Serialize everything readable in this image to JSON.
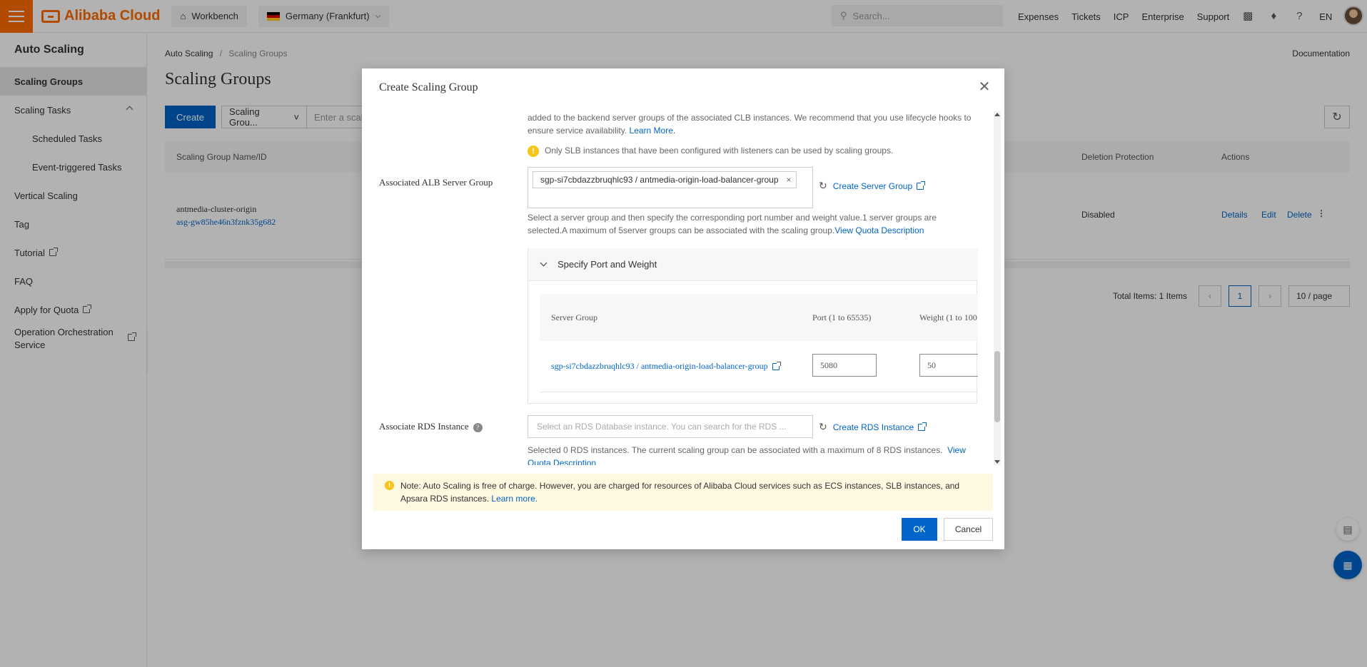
{
  "topbar": {
    "brand": "Alibaba Cloud",
    "workbench": "Workbench",
    "region": "Germany (Frankfurt)",
    "search_placeholder": "Search...",
    "links": [
      "Expenses",
      "Tickets",
      "ICP",
      "Enterprise",
      "Support"
    ],
    "lang": "EN"
  },
  "sidebar": {
    "title": "Auto Scaling",
    "items": {
      "scaling_groups": "Scaling Groups",
      "scaling_tasks": "Scaling Tasks",
      "scheduled_tasks": "Scheduled Tasks",
      "event_tasks": "Event-triggered Tasks",
      "vertical_scaling": "Vertical Scaling",
      "tag": "Tag",
      "tutorial": "Tutorial",
      "faq": "FAQ",
      "apply_quota": "Apply for Quota",
      "oos_line1": "Operation Orchestration",
      "oos_line2": "Service"
    }
  },
  "main": {
    "breadcrumb_root": "Auto Scaling",
    "breadcrumb_sep": "/",
    "breadcrumb_current": "Scaling Groups",
    "documentation": "Documentation",
    "title": "Scaling Groups",
    "create": "Create",
    "filter_select": "Scaling Grou...",
    "filter_placeholder": "Enter a scali",
    "table": {
      "col_name": "Scaling Group Name/ID",
      "col_deletion": "Deletion Protection",
      "col_actions": "Actions",
      "row_name": "antmedia-cluster-origin",
      "row_id": "asg-gw85he46n3fznk35g682",
      "row_deletion": "Disabled",
      "act_details": "Details",
      "act_edit": "Edit",
      "act_delete": "Delete"
    },
    "pager": {
      "total": "Total Items: 1 Items",
      "current": "1",
      "size": "10 / page"
    }
  },
  "dialog": {
    "title": "Create Scaling Group",
    "clb_text_line1": "added to the backend server groups of the associated CLB instances. We recommend that you use lifecycle hooks to",
    "clb_text_line2": "ensure service availability.",
    "learn_more": "Learn More.",
    "slb_warning": "Only SLB instances that have been configured with listeners can be used by scaling groups.",
    "alb_label": "Associated ALB Server Group",
    "alb_tag": "sgp-si7cbdazzbruqhlc93 / antmedia-origin-load-balancer-group",
    "create_server_group": "Create Server Group",
    "alb_help_line1": "Select a server group and then specify the corresponding port number and weight value.1 server groups are",
    "alb_help_line2": "selected.A maximum of 5server groups can be associated with the scaling group.",
    "view_quota": "View Quota Description",
    "port_weight_title": "Specify Port and Weight",
    "col_server_group": "Server Group",
    "col_port": "Port (1 to 65535)",
    "col_weight": "Weight (1 to 100",
    "row_server_group": "sgp-si7cbdazzbruqhlc93 / antmedia-origin-load-balancer-group",
    "row_port": "5080",
    "row_weight": "50",
    "rds_label": "Associate RDS Instance",
    "rds_placeholder": "Select an RDS Database instance. You can search for the RDS ...",
    "create_rds": "Create RDS Instance",
    "rds_help": "Selected 0 RDS instances. The current scaling group can be associated with a maximum of 8 RDS instances.",
    "rds_view": "View",
    "rds_quota": "Quota Description",
    "notice_line1": "Note: Auto Scaling is free of charge. However, you are charged for resources of Alibaba Cloud services such as ECS instances, SLB instances, and",
    "notice_line2": "Apsara RDS instances.",
    "notice_learn": "Learn more.",
    "ok": "OK",
    "cancel": "Cancel"
  },
  "colors": {
    "accent": "#0064c8",
    "brand": "#ff6a00",
    "warning": "#f5c518"
  }
}
